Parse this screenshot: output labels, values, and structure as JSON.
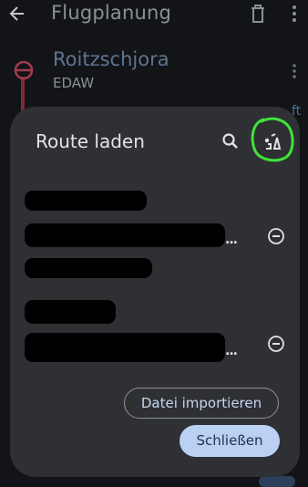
{
  "appbar": {
    "title": "Flugplanung",
    "back_icon": "arrow-back-icon",
    "delete_icon": "trash-icon",
    "more_icon": "more-vert-icon"
  },
  "waypoint": {
    "name": "Roitzschjora",
    "code": "EDAW",
    "peek_text": "ft"
  },
  "dialog": {
    "title": "Route laden",
    "search_icon": "search-icon",
    "load_icon": "route-load-icon",
    "annotation_color": "#3fe23a",
    "routes": [
      {
        "remove_icon": "remove-circle-icon",
        "ellipsis": "..."
      },
      {
        "remove_icon": "remove-circle-icon",
        "ellipsis": "..."
      }
    ],
    "import_label": "Datei importieren",
    "close_label": "Schließen"
  },
  "colors": {
    "background": "#131417",
    "dialog_bg": "#2f3033",
    "primary_container": "#bad1f4",
    "route_line": "#7d2a3c"
  }
}
